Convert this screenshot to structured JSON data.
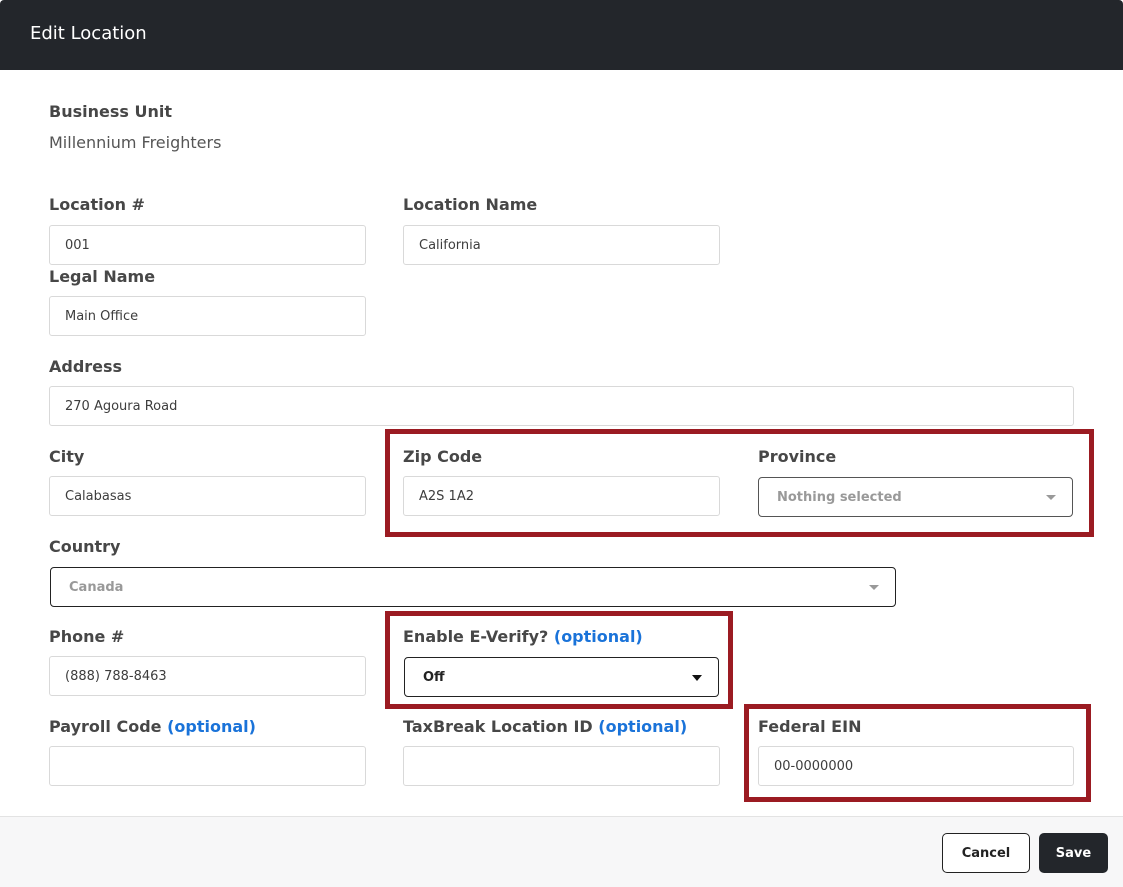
{
  "modal": {
    "title": "Edit Location"
  },
  "business_unit": {
    "label": "Business Unit",
    "value": "Millennium Freighters"
  },
  "fields": {
    "location_number": {
      "label": "Location #",
      "value": "001"
    },
    "location_name": {
      "label": "Location Name",
      "value": "California"
    },
    "legal_name": {
      "label": "Legal Name",
      "value": "Main Office"
    },
    "address": {
      "label": "Address",
      "value": "270 Agoura Road"
    },
    "city": {
      "label": "City",
      "value": "Calabasas"
    },
    "zip_code": {
      "label": "Zip Code",
      "value": "A2S 1A2"
    },
    "province": {
      "label": "Province",
      "selected": "Nothing selected"
    },
    "country": {
      "label": "Country",
      "selected": "Canada"
    },
    "phone": {
      "label": "Phone #",
      "value": "(888) 788-8463"
    },
    "e_verify": {
      "label": "Enable E-Verify?",
      "optional": "(optional)",
      "selected": "Off"
    },
    "payroll_code": {
      "label": "Payroll Code",
      "optional": "(optional)",
      "value": ""
    },
    "taxbreak_location_id": {
      "label": "TaxBreak Location ID",
      "optional": "(optional)",
      "value": ""
    },
    "federal_ein": {
      "label": "Federal EIN",
      "value": "00-0000000"
    }
  },
  "footer": {
    "cancel_label": "Cancel",
    "save_label": "Save"
  },
  "colors": {
    "header_bg": "#23262b",
    "highlight": "#9b1b22",
    "optional_link": "#1a73d9"
  }
}
